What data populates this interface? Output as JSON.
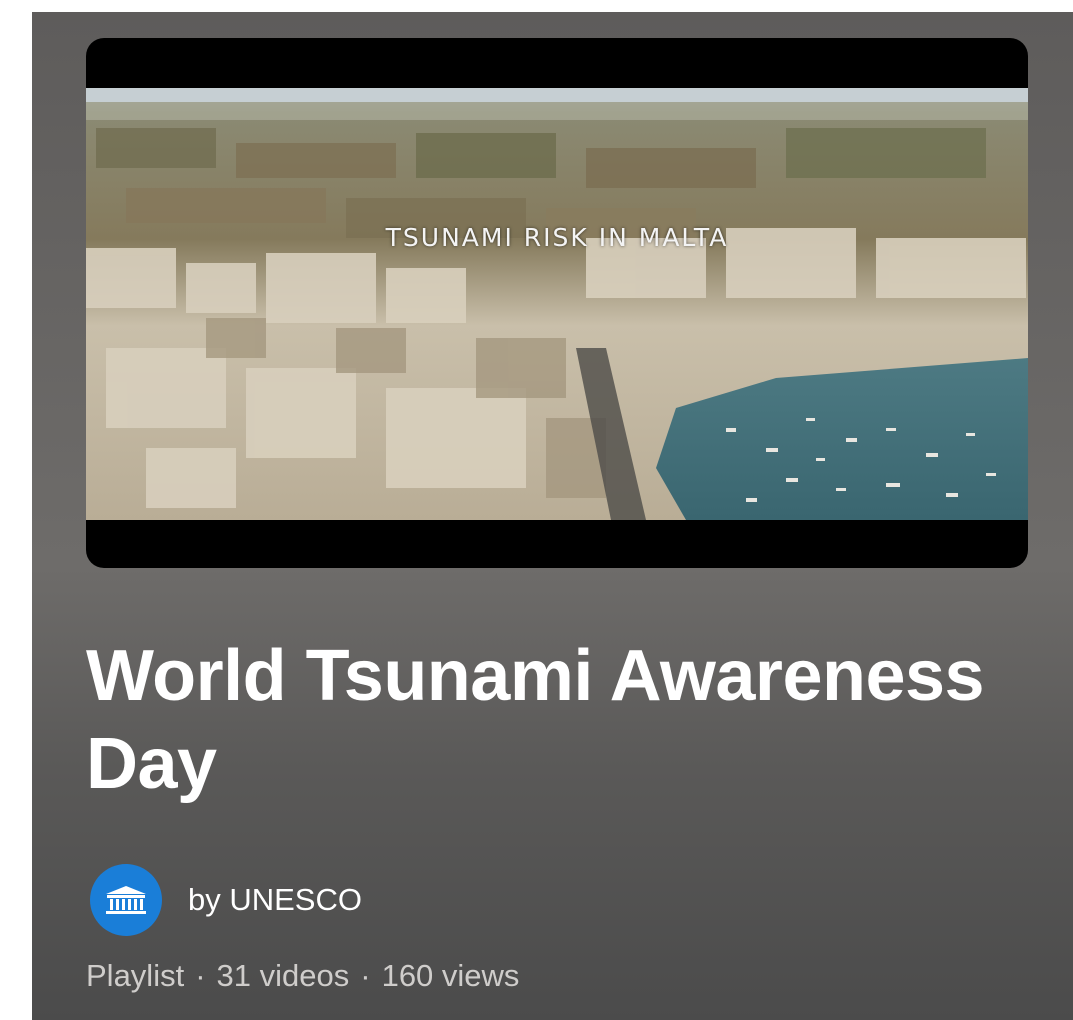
{
  "thumbnail": {
    "overlay_text": "TSUNAMI RISK IN MALTA"
  },
  "playlist": {
    "title": "World Tsunami Awareness Day",
    "owner_text": "by UNESCO",
    "type": "Playlist",
    "separator": "·",
    "video_count": "31 videos",
    "views": "160 views"
  },
  "icons": {
    "avatar": "unesco-temple-logo"
  },
  "colors": {
    "avatar_bg": "#1a7ed8",
    "title": "#ffffff",
    "meta": "#cfcdcb"
  }
}
